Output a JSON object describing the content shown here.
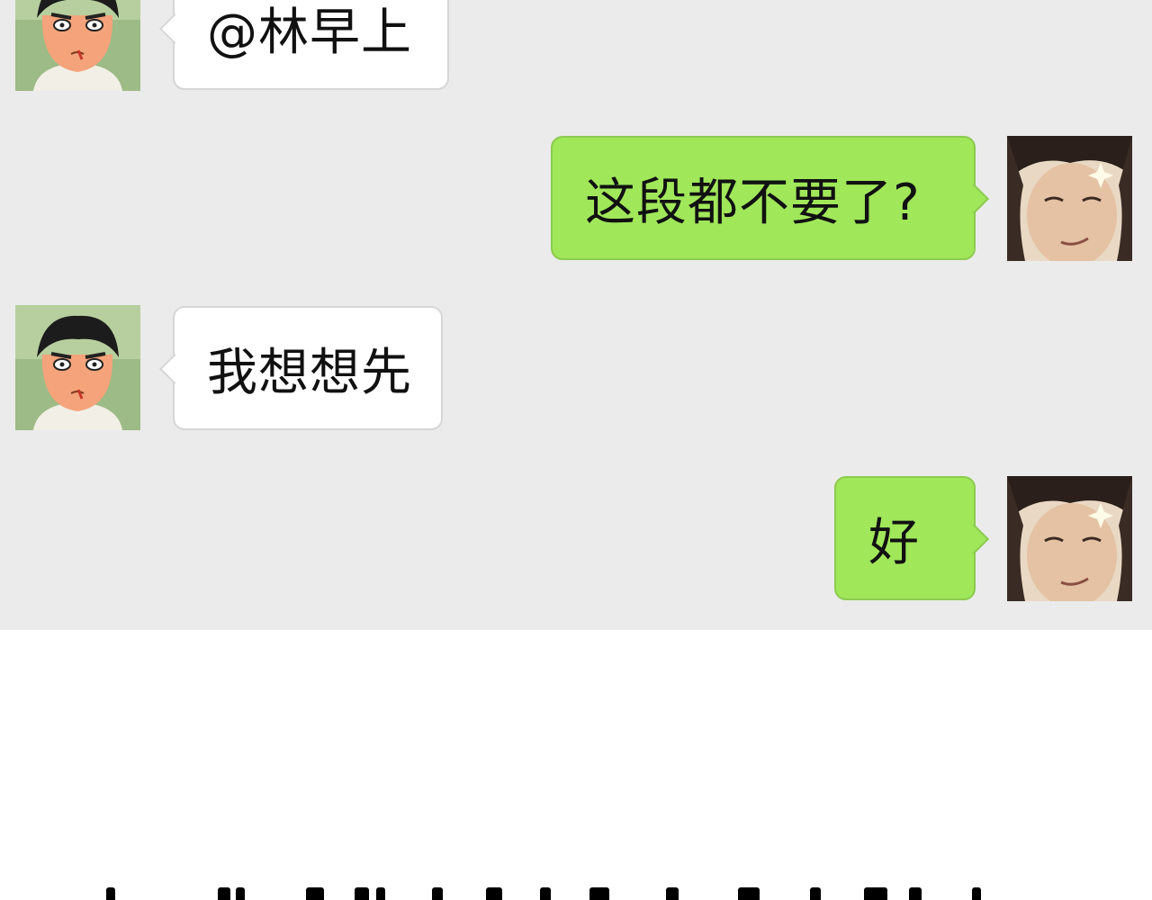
{
  "conversation": {
    "messages": [
      {
        "side": "in",
        "sender_avatar": "anime-boy-avatar",
        "text": "@林早上"
      },
      {
        "side": "out",
        "sender_avatar": "man-face-avatar",
        "text": "这段都不要了?"
      },
      {
        "side": "in",
        "sender_avatar": "anime-boy-avatar",
        "text": "我想想先"
      },
      {
        "side": "out",
        "sender_avatar": "man-face-avatar",
        "text": "好"
      }
    ]
  },
  "colors": {
    "chat_background": "#ebebeb",
    "outgoing_bubble": "#a0e75a",
    "incoming_bubble": "#ffffff",
    "page_background": "#ffffff"
  }
}
